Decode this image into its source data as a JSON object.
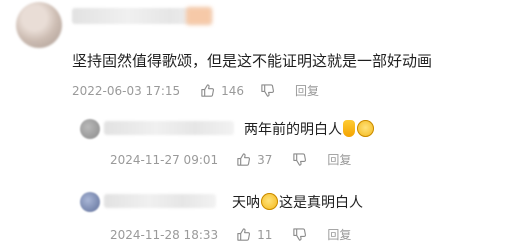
{
  "main_comment": {
    "text": "坚持固然值得歌颂，但是这不能证明这就是一部好动画",
    "timestamp": "2022-06-03 17:15",
    "likes": "146",
    "reply_label": "回复"
  },
  "replies": [
    {
      "text_before": "两年前的明白人",
      "emoji": [
        "thumbs-up-emoji",
        "dumbfounded-emoji"
      ],
      "timestamp": "2024-11-27 09:01",
      "likes": "37",
      "reply_label": "回复"
    },
    {
      "text_before": "天呐",
      "emoji": [
        "facepalm-emoji"
      ],
      "text_after": "这是真明白人",
      "timestamp": "2024-11-28 18:33",
      "likes": "11",
      "reply_label": "回复"
    }
  ]
}
